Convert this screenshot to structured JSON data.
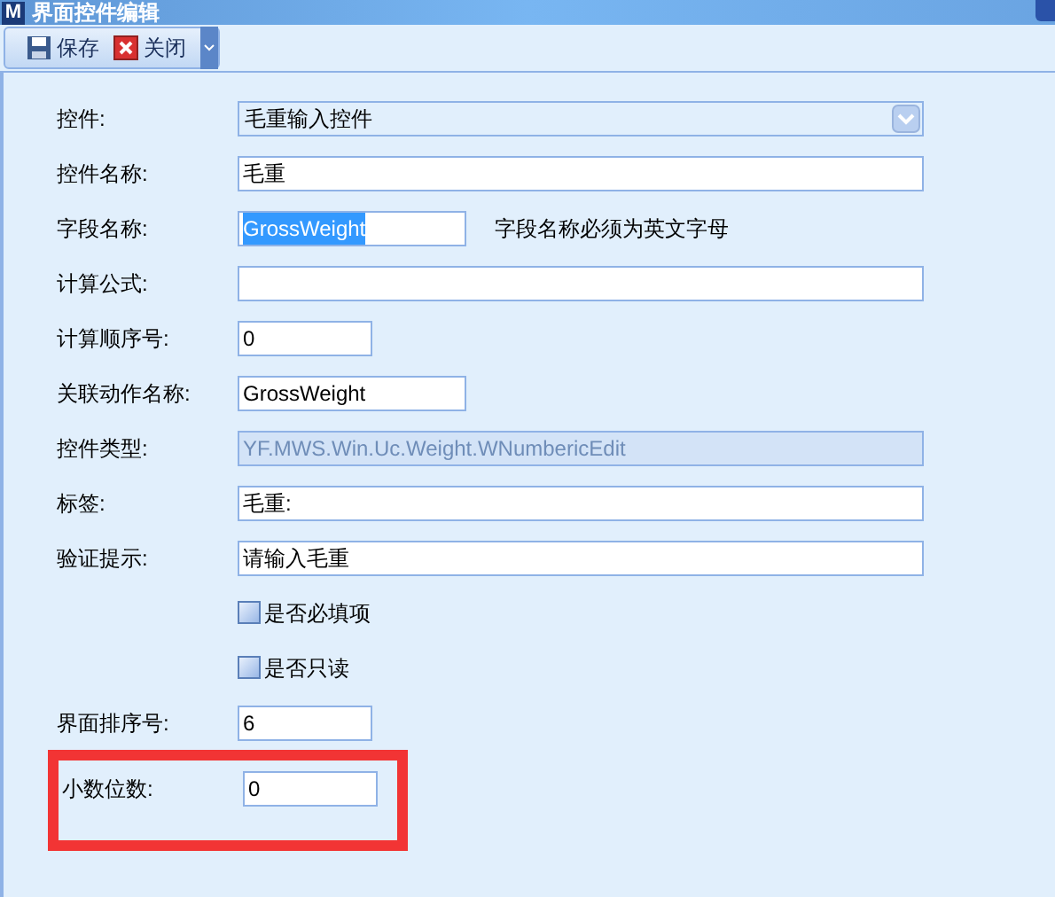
{
  "window": {
    "icon_letter": "M",
    "title": "界面控件编辑"
  },
  "toolbar": [
    {
      "label": "保存",
      "kind": "save"
    },
    {
      "label": "关闭",
      "kind": "close"
    }
  ],
  "form": [
    {
      "kind": "select",
      "label": "控件:",
      "value": "毛重输入控件"
    },
    {
      "kind": "long_field",
      "label": "控件名称:",
      "value": "毛重"
    },
    {
      "kind": "medium_field",
      "label": "字段名称:",
      "value": "GrossWeight",
      "text_selected": true,
      "note": "字段名称必须为英文字母"
    },
    {
      "kind": "long_field",
      "label": "计算公式:"
    },
    {
      "kind": "short_field",
      "label": "计算顺序号:",
      "value": "0"
    },
    {
      "kind": "medium_field",
      "label": "关联动作名称:",
      "value": "GrossWeight"
    },
    {
      "kind": "long_field",
      "label": "控件类型:",
      "value": "YF.MWS.Win.Uc.Weight.WNumbericEdit",
      "disabled": true
    },
    {
      "kind": "long_field",
      "label": "标签:",
      "value": "毛重:"
    },
    {
      "kind": "long_field",
      "label": "验证提示:",
      "value": "请输入毛重"
    },
    {
      "kind": "checkbox",
      "label": "是否必填项",
      "checked": false
    },
    {
      "kind": "checkbox",
      "label": "是否只读",
      "checked": false
    },
    {
      "kind": "short_field",
      "label": "界面排序号:",
      "value": "6"
    },
    {
      "kind": "short_field",
      "label": "小数位数:",
      "value": "0",
      "highlighted": true
    }
  ]
}
